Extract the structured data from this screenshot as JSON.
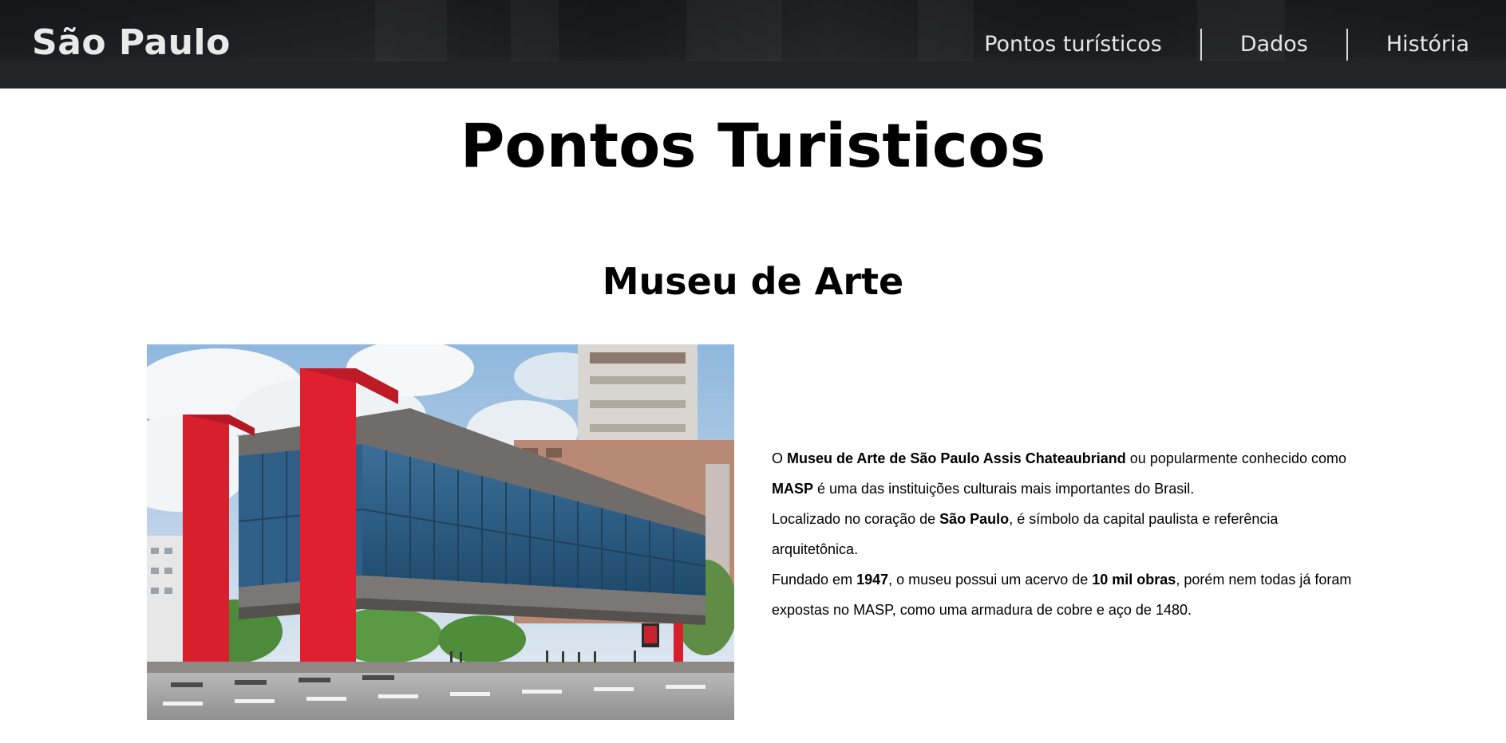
{
  "header": {
    "brand": "São Paulo",
    "nav": [
      {
        "label": "Pontos turísticos"
      },
      {
        "label": "Dados"
      },
      {
        "label": "História"
      }
    ]
  },
  "main": {
    "page_title": "Pontos Turisticos",
    "section": {
      "title": "Museu de Arte",
      "image_icon": "museum-photo",
      "paragraphs": [
        {
          "segments": [
            {
              "text": "O ",
              "bold": false
            },
            {
              "text": "Museu de Arte de São Paulo Assis Chateaubriand",
              "bold": true
            },
            {
              "text": " ou popularmente conhecido como ",
              "bold": false
            },
            {
              "text": "MASP",
              "bold": true
            },
            {
              "text": " é uma das instituições culturais mais importantes do Brasil.",
              "bold": false
            }
          ]
        },
        {
          "segments": [
            {
              "text": "Localizado no coração de ",
              "bold": false
            },
            {
              "text": "São Paulo",
              "bold": true
            },
            {
              "text": ", é símbolo da capital paulista e referência arquitetônica.",
              "bold": false
            }
          ]
        },
        {
          "segments": [
            {
              "text": "Fundado em ",
              "bold": false
            },
            {
              "text": "1947",
              "bold": true
            },
            {
              "text": ", o museu possui um acervo de ",
              "bold": false
            },
            {
              "text": "10 mil obras",
              "bold": true
            },
            {
              "text": ", porém nem todas já foram expostas no MASP, como uma armadura de cobre e aço de 1480.",
              "bold": false
            }
          ]
        }
      ]
    }
  },
  "colors": {
    "header_bg": "#1c1d21",
    "nav_text": "#e6e6e6",
    "masp_red": "#d8202c",
    "glass_blue": "#2d5f86"
  }
}
